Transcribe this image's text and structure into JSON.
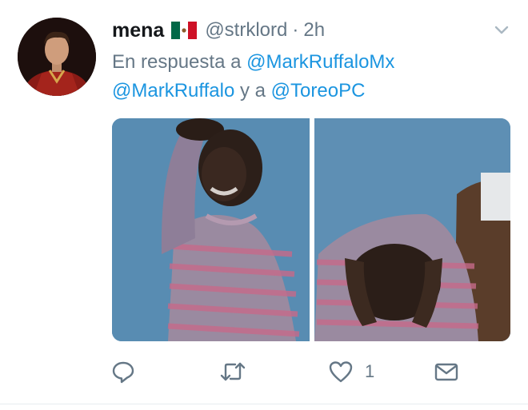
{
  "tweet": {
    "display_name": "mena",
    "flag": "mexico-flag",
    "handle": "@strklord",
    "separator": "·",
    "time": "2h",
    "reply_prefix": "En respuesta a",
    "mention_1": "@MarkRuffaloMx",
    "mention_2": "@MarkRuffalo",
    "reply_join": "y a",
    "mention_3": "@ToreoPC",
    "like_count": "1"
  },
  "colors": {
    "link": "#1b95e0",
    "secondary_text": "#657786",
    "primary_text": "#14171a",
    "icon": "#657786"
  },
  "icons": [
    "chevron-down-icon",
    "reply-icon",
    "retweet-icon",
    "heart-icon",
    "envelope-icon"
  ]
}
